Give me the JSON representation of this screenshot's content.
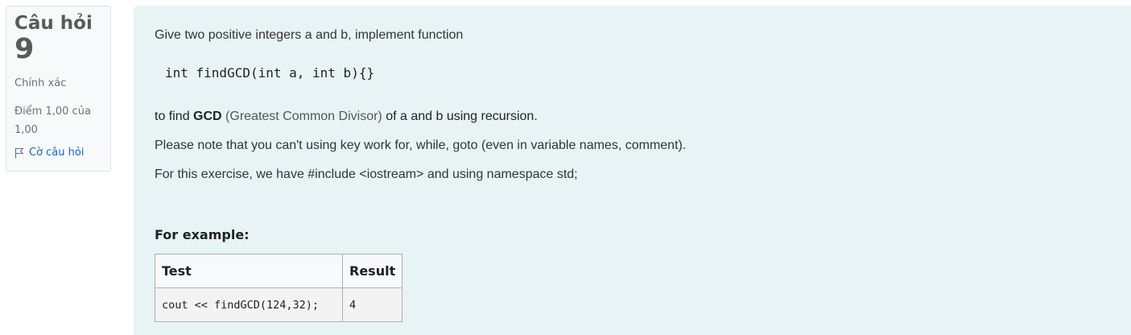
{
  "question_info": {
    "label": "Câu hỏi",
    "number": "9",
    "state": "Chính xác",
    "grade": "Điểm 1,00 của 1,00",
    "flag_label": "Cờ câu hỏi",
    "flag_icon": "flag-icon"
  },
  "question_text": {
    "intro": "Give two positive integers a and b, implement function",
    "code_signature": "int findGCD(int a, int b){}",
    "line2_prefix": "to find ",
    "line2_bold": "GCD",
    "line2_muted": " (Greatest Common Divisor)",
    "line2_suffix": " of a and b using recursion.",
    "line3": "Please note that you can't using key work for, while, goto (even in variable names, comment).",
    "line4": "For this exercise, we have #include <iostream> and using namespace std;",
    "example_title": "For example:"
  },
  "examples_table": {
    "headers": [
      "Test",
      "Result"
    ],
    "rows": [
      [
        "cout << findGCD(124,32);",
        "4"
      ]
    ]
  },
  "colors": {
    "content_bg": "#e7f3f5",
    "info_bg": "#f8f9fa",
    "link": "#0f6cbf"
  }
}
